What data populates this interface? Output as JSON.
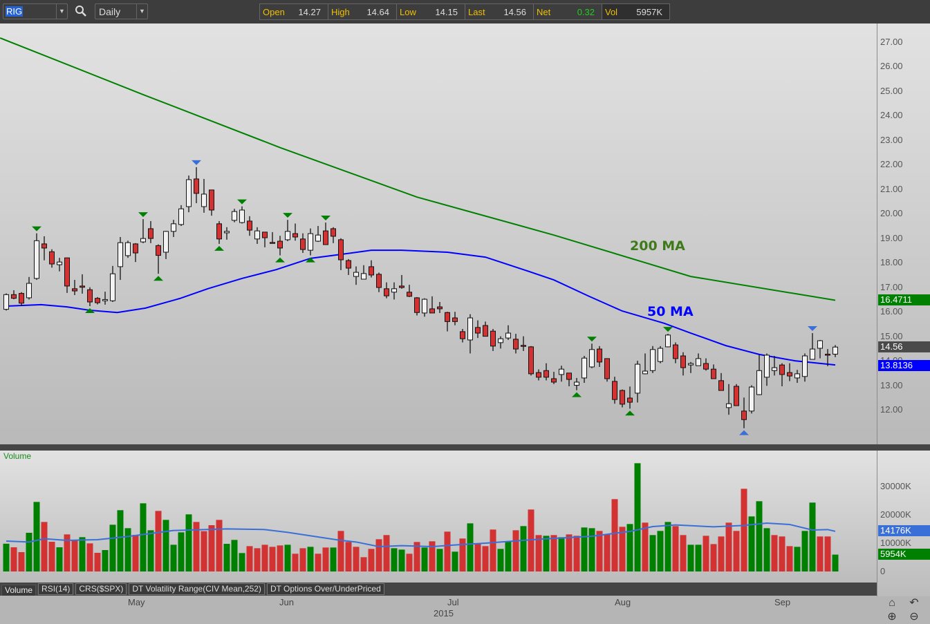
{
  "toolbar": {
    "symbol": "RIG",
    "period": "Daily",
    "quote": [
      {
        "k": "Open",
        "v": "14.27"
      },
      {
        "k": "High",
        "v": "14.64"
      },
      {
        "k": "Low",
        "v": "14.15"
      },
      {
        "k": "Last",
        "v": "14.56"
      },
      {
        "k": "Net",
        "v": "0.32"
      },
      {
        "k": "Vol",
        "v": "5957K"
      }
    ]
  },
  "colors": {
    "up_candle": "#f2f2f2",
    "down_candle": "#d33232",
    "vol_up": "#008000",
    "vol_down": "#d33232",
    "ma50": "#0000ff",
    "ma200": "#008000",
    "vol_ma": "#3a6fd8",
    "net": "#22cc22"
  },
  "price_axis": {
    "ticks": [
      "27.00",
      "26.00",
      "25.00",
      "24.00",
      "23.00",
      "22.00",
      "21.00",
      "20.00",
      "19.00",
      "18.00",
      "17.00",
      "16.00",
      "15.00",
      "14.00",
      "13.00",
      "12.00"
    ],
    "tag_ma200": "16.4711",
    "tag_last": "14.56",
    "tag_ma50": "13.8136"
  },
  "ma_labels": {
    "ma200": "200 MA",
    "ma50": "50 MA"
  },
  "volume_panel": {
    "title": "Volume",
    "ticks": [
      "30000K",
      "20000K",
      "10000K",
      "0"
    ],
    "tag_ma": "14176K",
    "tag_last": "5954K"
  },
  "tabs": [
    "Volume",
    "RSI(14)",
    "CRS($SPX)",
    "DT Volatility Range(CIV Mean,252)",
    "DT Options Over/UnderPriced"
  ],
  "time_axis": {
    "months": [
      "May",
      "Jun",
      "Jul",
      "Aug",
      "Sep"
    ],
    "year": "2015"
  },
  "chart_data": {
    "type": "candlestick",
    "symbol": "RIG",
    "period": "Daily",
    "ylim": [
      11,
      27.7
    ],
    "volume_ylim_k": [
      0,
      42000
    ],
    "candles": [
      [
        16.1,
        16.75,
        16.05,
        16.7
      ],
      [
        16.7,
        16.88,
        16.51,
        16.55
      ],
      [
        16.75,
        16.8,
        16.25,
        16.35
      ],
      [
        16.57,
        17.42,
        16.5,
        17.16
      ],
      [
        17.36,
        19.2,
        17.3,
        18.9
      ],
      [
        18.77,
        19.08,
        18.1,
        18.6
      ],
      [
        18.45,
        18.55,
        17.8,
        17.95
      ],
      [
        17.92,
        18.2,
        17.65,
        18.03
      ],
      [
        18.2,
        18.2,
        16.77,
        17.05
      ],
      [
        16.94,
        17.3,
        16.68,
        16.85
      ],
      [
        17.05,
        17.53,
        16.74,
        17.0
      ],
      [
        16.9,
        17.0,
        16.23,
        16.4
      ],
      [
        16.55,
        16.6,
        16.3,
        16.37
      ],
      [
        16.45,
        16.82,
        16.29,
        16.5
      ],
      [
        16.45,
        17.87,
        16.4,
        17.55
      ],
      [
        17.84,
        19.05,
        17.3,
        18.82
      ],
      [
        18.29,
        18.9,
        18.2,
        18.82
      ],
      [
        18.77,
        18.8,
        18.03,
        18.4
      ],
      [
        18.85,
        19.78,
        18.8,
        18.99
      ],
      [
        19.39,
        19.7,
        18.8,
        18.99
      ],
      [
        18.7,
        18.75,
        17.55,
        18.3
      ],
      [
        18.43,
        19.3,
        18.15,
        19.28
      ],
      [
        19.28,
        19.75,
        19.05,
        19.59
      ],
      [
        19.56,
        20.35,
        19.5,
        20.2
      ],
      [
        20.29,
        21.56,
        20.06,
        21.39
      ],
      [
        21.42,
        21.9,
        20.43,
        20.83
      ],
      [
        20.29,
        21.42,
        20.04,
        20.8
      ],
      [
        20.97,
        20.97,
        19.92,
        20.15
      ],
      [
        19.59,
        19.7,
        18.77,
        18.97
      ],
      [
        19.22,
        19.45,
        18.94,
        19.28
      ],
      [
        19.73,
        20.2,
        19.65,
        20.09
      ],
      [
        19.64,
        20.3,
        19.6,
        20.15
      ],
      [
        19.7,
        19.9,
        19.1,
        19.33
      ],
      [
        18.97,
        19.45,
        18.77,
        19.3
      ],
      [
        19.25,
        19.25,
        18.63,
        19.02
      ],
      [
        18.83,
        19.25,
        18.8,
        18.82
      ],
      [
        18.88,
        19.1,
        18.3,
        18.6
      ],
      [
        18.94,
        19.75,
        18.88,
        19.28
      ],
      [
        19.19,
        19.6,
        18.9,
        19.05
      ],
      [
        18.97,
        19.2,
        18.4,
        18.54
      ],
      [
        18.51,
        19.4,
        18.3,
        19.19
      ],
      [
        18.88,
        19.5,
        18.85,
        19.13
      ],
      [
        19.3,
        19.64,
        18.74,
        18.74
      ],
      [
        19.39,
        19.45,
        18.8,
        19.08
      ],
      [
        18.94,
        19.0,
        17.7,
        18.12
      ],
      [
        18.09,
        18.15,
        17.5,
        17.78
      ],
      [
        17.44,
        17.85,
        17.1,
        17.61
      ],
      [
        17.33,
        17.9,
        17.33,
        17.56
      ],
      [
        17.84,
        18.1,
        17.4,
        17.5
      ],
      [
        17.53,
        17.6,
        16.8,
        16.99
      ],
      [
        16.94,
        17.2,
        16.55,
        16.65
      ],
      [
        16.8,
        17.2,
        16.5,
        16.94
      ],
      [
        17.05,
        17.5,
        16.94,
        16.99
      ],
      [
        16.8,
        17.1,
        16.6,
        16.63
      ],
      [
        16.57,
        16.6,
        15.85,
        15.97
      ],
      [
        15.95,
        16.55,
        15.8,
        16.51
      ],
      [
        16.12,
        16.63,
        15.95,
        15.95
      ],
      [
        16.2,
        16.4,
        15.95,
        16.12
      ],
      [
        15.97,
        16.0,
        15.2,
        15.6
      ],
      [
        15.75,
        16.0,
        15.45,
        15.6
      ],
      [
        15.19,
        15.3,
        14.75,
        14.9
      ],
      [
        14.85,
        15.9,
        14.3,
        15.75
      ],
      [
        15.36,
        15.65,
        14.93,
        15.13
      ],
      [
        15.44,
        15.6,
        15.0,
        15.0
      ],
      [
        15.21,
        15.3,
        14.4,
        14.6
      ],
      [
        14.74,
        15.0,
        14.5,
        14.9
      ],
      [
        14.93,
        15.45,
        14.85,
        15.13
      ],
      [
        14.88,
        15.1,
        14.3,
        14.48
      ],
      [
        14.63,
        15.0,
        14.4,
        14.62
      ],
      [
        14.57,
        14.6,
        13.4,
        13.47
      ],
      [
        13.52,
        13.65,
        13.2,
        13.33
      ],
      [
        13.6,
        13.9,
        13.2,
        13.33
      ],
      [
        13.27,
        13.55,
        13.05,
        13.13
      ],
      [
        13.44,
        13.8,
        13.15,
        13.66
      ],
      [
        13.5,
        13.5,
        12.96,
        13.24
      ],
      [
        13.0,
        13.3,
        12.8,
        13.13
      ],
      [
        13.3,
        14.2,
        13.1,
        14.11
      ],
      [
        13.75,
        14.7,
        13.7,
        14.46
      ],
      [
        14.48,
        14.6,
        13.75,
        13.95
      ],
      [
        14.09,
        14.1,
        13.15,
        13.27
      ],
      [
        13.16,
        13.35,
        12.25,
        12.42
      ],
      [
        12.79,
        12.83,
        12.1,
        12.23
      ],
      [
        12.48,
        12.95,
        12.05,
        12.31
      ],
      [
        12.68,
        14.0,
        12.3,
        13.86
      ],
      [
        13.47,
        14.3,
        13.45,
        13.58
      ],
      [
        13.6,
        14.6,
        13.5,
        14.46
      ],
      [
        13.97,
        14.6,
        13.9,
        14.51
      ],
      [
        14.57,
        15.1,
        14.55,
        15.05
      ],
      [
        14.65,
        14.75,
        13.9,
        14.09
      ],
      [
        14.2,
        14.35,
        13.4,
        13.72
      ],
      [
        13.83,
        13.95,
        13.5,
        13.89
      ],
      [
        13.8,
        14.3,
        13.8,
        14.09
      ],
      [
        13.89,
        14.1,
        13.6,
        13.66
      ],
      [
        13.66,
        13.85,
        13.27,
        13.27
      ],
      [
        13.19,
        13.5,
        12.79,
        12.79
      ],
      [
        12.09,
        13.05,
        11.8,
        12.25
      ],
      [
        12.96,
        13.05,
        12.17,
        12.17
      ],
      [
        11.95,
        12.5,
        11.25,
        11.6
      ],
      [
        11.95,
        13.0,
        11.85,
        12.93
      ],
      [
        12.62,
        14.26,
        12.6,
        13.6
      ],
      [
        13.33,
        14.3,
        12.98,
        14.23
      ],
      [
        13.6,
        14.2,
        13.4,
        13.72
      ],
      [
        13.83,
        13.9,
        12.96,
        13.44
      ],
      [
        13.52,
        13.9,
        13.17,
        13.38
      ],
      [
        13.3,
        13.63,
        13.1,
        13.47
      ],
      [
        13.36,
        14.3,
        13.15,
        14.2
      ],
      [
        14.06,
        15.13,
        14.05,
        14.48
      ],
      [
        14.51,
        14.85,
        14.1,
        14.82
      ],
      [
        14.27,
        14.48,
        13.78,
        14.26
      ],
      [
        14.27,
        14.64,
        14.15,
        14.56
      ]
    ],
    "volume_k": [
      9800,
      8540,
      6830,
      13660,
      24550,
      17480,
      10490,
      8540,
      13090,
      11220,
      12110,
      9920,
      6590,
      7560,
      16500,
      21630,
      15280,
      12930,
      24060,
      14550,
      21380,
      18210,
      9430,
      13820,
      20160,
      17480,
      14230,
      16340,
      18210,
      9760,
      11140,
      6500,
      8940,
      8210,
      9430,
      8700,
      9190,
      9430,
      6260,
      8210,
      8700,
      6260,
      8460,
      8460,
      14310,
      10410,
      8700,
      5040,
      7970,
      11380,
      12850,
      8210,
      7720,
      6260,
      10410,
      8460,
      10650,
      7970,
      14070,
      6990,
      11630,
      16990,
      9920,
      8940,
      14800,
      7970,
      10650,
      14550,
      16020,
      21870,
      12850,
      12600,
      12850,
      12110,
      13090,
      12600,
      15530,
      15280,
      14310,
      13090,
      25530,
      15770,
      16750,
      38210,
      17240,
      12850,
      14310,
      17480,
      16020,
      12850,
      9430,
      9430,
      12600,
      9670,
      12360,
      17240,
      14310,
      29190,
      19430,
      24800,
      15280,
      12850,
      12360,
      8940,
      8700,
      14310,
      24310,
      12360,
      12360,
      5954
    ],
    "volume_dir": "GRRGGRRGRRGRRGGGGRGGRGGGGRRRRGGGRRRRRGRRGRRGRRRRRRRGGRRGRGRGRGRRRGGRGRRGRGRRGGRRRRGGRGGGRRGGRRRRRRGGGRRRGGGRRG",
    "ma200": [
      [
        0,
        27.0
      ],
      [
        18,
        24.86
      ],
      [
        36,
        22.7
      ],
      [
        54,
        20.68
      ],
      [
        72,
        19.13
      ],
      [
        90,
        17.44
      ],
      [
        109,
        16.47
      ]
    ],
    "ma50": [
      [
        0,
        16.23
      ],
      [
        4.6,
        16.29
      ],
      [
        8,
        16.2
      ],
      [
        11,
        16.06
      ],
      [
        14.6,
        15.97
      ],
      [
        18.3,
        16.15
      ],
      [
        22.8,
        16.54
      ],
      [
        26.5,
        16.94
      ],
      [
        31,
        17.36
      ],
      [
        35.5,
        17.72
      ],
      [
        40,
        18.18
      ],
      [
        44,
        18.34
      ],
      [
        48,
        18.51
      ],
      [
        52,
        18.51
      ],
      [
        58,
        18.43
      ],
      [
        63,
        18.23
      ],
      [
        68,
        17.72
      ],
      [
        72,
        17.3
      ],
      [
        76.5,
        16.65
      ],
      [
        81,
        16.03
      ],
      [
        86.5,
        15.53
      ],
      [
        90,
        15.13
      ],
      [
        94.6,
        14.62
      ],
      [
        99,
        14.26
      ],
      [
        103.7,
        14.0
      ],
      [
        109,
        13.83
      ]
    ],
    "volume_ma_k": [
      [
        0,
        10730
      ],
      [
        3,
        10410
      ],
      [
        5,
        11540
      ],
      [
        8,
        10980
      ],
      [
        12,
        11220
      ],
      [
        16,
        12360
      ],
      [
        22,
        14470
      ],
      [
        29,
        15040
      ],
      [
        34,
        14800
      ],
      [
        37,
        13820
      ],
      [
        40,
        12600
      ],
      [
        44,
        10980
      ],
      [
        46,
        10410
      ],
      [
        49,
        8780
      ],
      [
        52,
        9110
      ],
      [
        56,
        8780
      ],
      [
        59,
        9350
      ],
      [
        63,
        10000
      ],
      [
        70,
        11380
      ],
      [
        77,
        12440
      ],
      [
        82,
        14150
      ],
      [
        85,
        15850
      ],
      [
        88,
        16420
      ],
      [
        93,
        15770
      ],
      [
        97,
        16260
      ],
      [
        100,
        17070
      ],
      [
        103,
        16590
      ],
      [
        106,
        14630
      ],
      [
        108,
        14800
      ],
      [
        109,
        14176
      ]
    ],
    "markers": [
      {
        "i": 4,
        "pos": "top",
        "c": "#008000"
      },
      {
        "i": 11,
        "pos": "bottom",
        "c": "#008000"
      },
      {
        "i": 18,
        "pos": "top",
        "c": "#008000"
      },
      {
        "i": 20,
        "pos": "bottom",
        "c": "#008000"
      },
      {
        "i": 25,
        "pos": "top",
        "c": "#3a6fd8"
      },
      {
        "i": 28,
        "pos": "bottom",
        "c": "#008000"
      },
      {
        "i": 31,
        "pos": "top",
        "c": "#008000"
      },
      {
        "i": 36,
        "pos": "bottom",
        "c": "#008000"
      },
      {
        "i": 37,
        "pos": "top",
        "c": "#008000"
      },
      {
        "i": 40,
        "pos": "bottom",
        "c": "#008000"
      },
      {
        "i": 42,
        "pos": "top",
        "c": "#008000"
      },
      {
        "i": 75,
        "pos": "bottom",
        "c": "#008000"
      },
      {
        "i": 77,
        "pos": "top",
        "c": "#008000"
      },
      {
        "i": 82,
        "pos": "bottom",
        "c": "#008000"
      },
      {
        "i": 87,
        "pos": "top",
        "c": "#008000"
      },
      {
        "i": 97,
        "pos": "bottom",
        "c": "#3a6fd8"
      },
      {
        "i": 106,
        "pos": "top",
        "c": "#3a6fd8"
      }
    ]
  }
}
